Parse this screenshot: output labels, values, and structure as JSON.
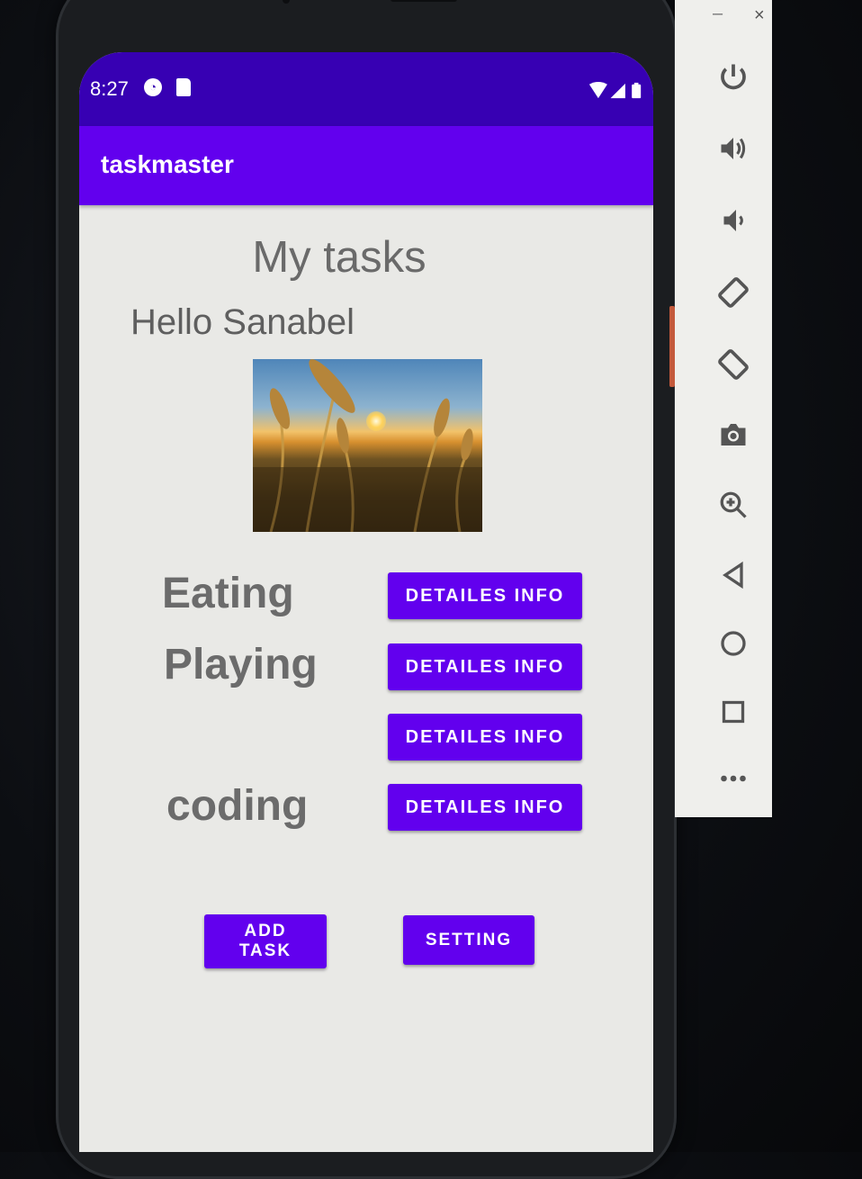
{
  "status_bar": {
    "time": "8:27"
  },
  "app_bar": {
    "title": "taskmaster"
  },
  "main": {
    "heading": "My tasks",
    "greeting": "Hello Sanabel",
    "tasks": [
      {
        "label": "Eating",
        "button": "DETAILES INFO"
      },
      {
        "label": "Playing",
        "button": "DETAILES INFO"
      },
      {
        "label": "",
        "button": "DETAILES INFO"
      },
      {
        "label": "coding",
        "button": "DETAILES INFO"
      }
    ],
    "add_task_button": "ADD TASK",
    "setting_button": "SETTING"
  },
  "emulator_toolbar": {
    "minimize": "–",
    "close": "×",
    "icons": [
      "power-icon",
      "volume-up-icon",
      "volume-down-icon",
      "rotate-left-icon",
      "rotate-right-icon",
      "camera-icon",
      "zoom-icon",
      "back-icon",
      "home-icon",
      "overview-icon",
      "more-icon"
    ]
  },
  "colors": {
    "primary": "#6200ee",
    "primary_dark": "#3700b3",
    "background": "#e9e9e6"
  }
}
